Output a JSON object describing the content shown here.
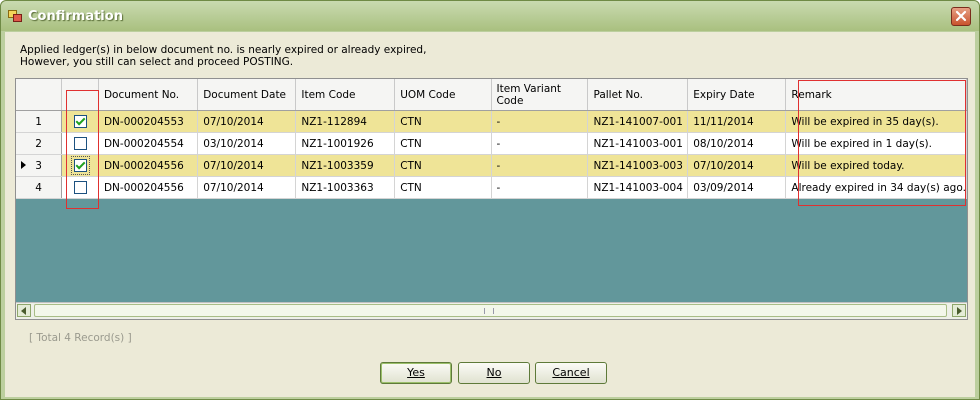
{
  "window": {
    "title": "Confirmation"
  },
  "message": {
    "line1": "Applied ledger(s) in below document no. is nearly expired or already expired,",
    "line2": "However, you still can select and proceed POSTING."
  },
  "columns": [
    "Document No.",
    "Document Date",
    "Item Code",
    "UOM Code",
    "Item Variant Code",
    "Pallet No.",
    "Expiry Date",
    "Remark"
  ],
  "rows": [
    {
      "num": "1",
      "checked": true,
      "doc_no": "DN-000204553",
      "doc_date": "07/10/2014",
      "item_code": "NZ1-112894",
      "uom": "CTN",
      "variant": "-",
      "pallet": "NZ1-141007-001",
      "expiry": "11/11/2014",
      "remark": "Will be expired in 35 day(s)."
    },
    {
      "num": "2",
      "checked": false,
      "doc_no": "DN-000204554",
      "doc_date": "03/10/2014",
      "item_code": "NZ1-1001926",
      "uom": "CTN",
      "variant": "-",
      "pallet": "NZ1-141003-001",
      "expiry": "08/10/2014",
      "remark": "Will be expired in 1 day(s)."
    },
    {
      "num": "3",
      "checked": true,
      "doc_no": "DN-000204556",
      "doc_date": "07/10/2014",
      "item_code": "NZ1-1003359",
      "uom": "CTN",
      "variant": "-",
      "pallet": "NZ1-141003-003",
      "expiry": "07/10/2014",
      "remark": "Will be expired today."
    },
    {
      "num": "4",
      "checked": false,
      "doc_no": "DN-000204556",
      "doc_date": "07/10/2014",
      "item_code": "NZ1-1003363",
      "uom": "CTN",
      "variant": "-",
      "pallet": "NZ1-141003-004",
      "expiry": "03/09/2014",
      "remark": "Already expired in 34 day(s) ago."
    }
  ],
  "current_row": "3",
  "footer": {
    "total": "[ Total 4 Record(s) ]"
  },
  "buttons": {
    "yes": "Yes",
    "no": "No",
    "cancel": "Cancel"
  },
  "colors": {
    "highlight_row": "#efe497",
    "grid_empty": "#62979b",
    "annotation": "#e03030"
  },
  "icons": {
    "app": "app-window-icon",
    "close": "close-x-icon",
    "current_row": "row-pointer-icon"
  }
}
